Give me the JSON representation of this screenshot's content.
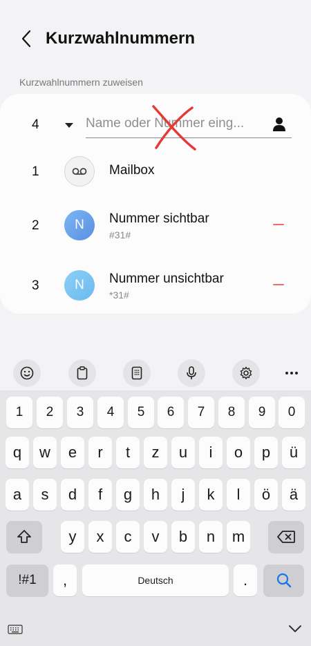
{
  "header": {
    "title": "Kurzwahlnummern"
  },
  "section_label": "Kurzwahlnummern zuweisen",
  "entry": {
    "number": "4",
    "placeholder": "Name oder Nummer eing..."
  },
  "list": [
    {
      "number": "1",
      "title": "Mailbox",
      "subtitle": "",
      "avatar": "voicemail-icon"
    },
    {
      "number": "2",
      "title": "Nummer sichtbar",
      "subtitle": "#31#",
      "avatar": "N"
    },
    {
      "number": "3",
      "title": "Nummer unsichtbar",
      "subtitle": "*31#",
      "avatar": "N"
    }
  ],
  "colors": {
    "accent_remove": "#f06a6a",
    "cross": "#e53935",
    "avatar_blue": "#6aa6ec",
    "search_key": "#1a73e8"
  },
  "keyboard": {
    "row_numbers": [
      "1",
      "2",
      "3",
      "4",
      "5",
      "6",
      "7",
      "8",
      "9",
      "0"
    ],
    "row1": [
      "q",
      "w",
      "e",
      "r",
      "t",
      "z",
      "u",
      "i",
      "o",
      "p",
      "ü"
    ],
    "row2": [
      "a",
      "s",
      "d",
      "f",
      "g",
      "h",
      "j",
      "k",
      "l",
      "ö",
      "ä"
    ],
    "row3": [
      "y",
      "x",
      "c",
      "v",
      "b",
      "n",
      "m"
    ],
    "symbols_key": "!#1",
    "comma_key": ",",
    "space_label": "Deutsch",
    "period_key": "."
  }
}
